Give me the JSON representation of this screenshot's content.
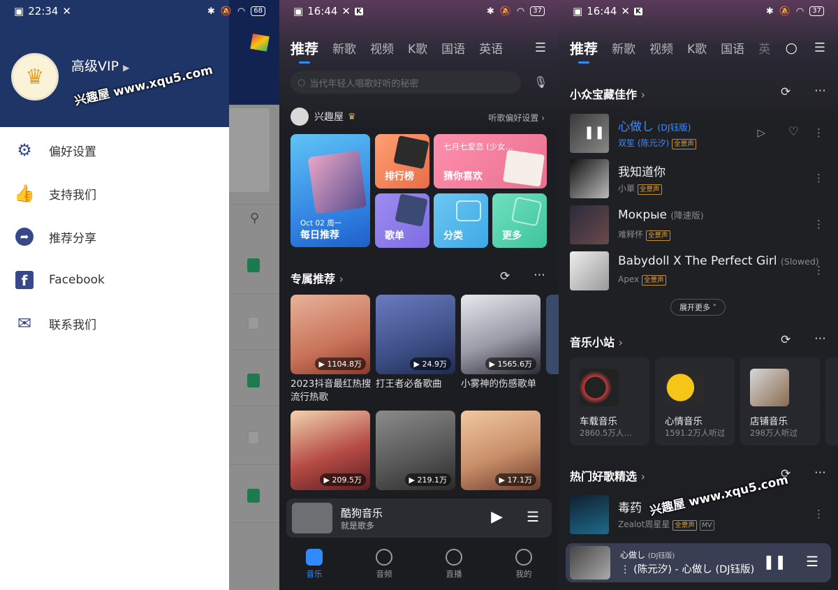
{
  "status_bar": [
    {
      "time": "22:34",
      "battery": "68"
    },
    {
      "time": "16:44",
      "battery": "37"
    },
    {
      "time": "16:44",
      "battery": "37"
    }
  ],
  "drawer": {
    "vip_label": "高级VIP",
    "watermark": "兴趣屋 www.xqu5.com",
    "menu": [
      {
        "label": "偏好设置",
        "icon": "gear-icon"
      },
      {
        "label": "支持我们",
        "icon": "thumbs-up-icon"
      },
      {
        "label": "推荐分享",
        "icon": "share-icon"
      },
      {
        "label": "Facebook",
        "icon": "facebook-icon"
      },
      {
        "label": "联系我们",
        "icon": "mail-icon"
      }
    ]
  },
  "music_home": {
    "tabs": [
      "推荐",
      "新歌",
      "视频",
      "K歌",
      "国语",
      "英语"
    ],
    "search_placeholder": "当代年轻人唱歌好听的秘密",
    "user_name": "兴趣屋",
    "pref_link": "听歌偏好设置 ›",
    "tiles": {
      "daily_date": "Oct 02 周一",
      "daily": "每日推荐",
      "rank": "排行榜",
      "guess": "猜你喜欢",
      "guess_sub": "七月七爱恋 (少女…",
      "songlist": "歌单",
      "category": "分类",
      "more": "更多"
    },
    "section_title": "专属推荐",
    "playlists": [
      {
        "count": "▶ 1104.8万",
        "title": "2023抖音最红热搜流行热歌",
        "color": "#c9735a"
      },
      {
        "count": "▶ 24.9万",
        "title": "打王者必备歌曲",
        "color": "#3d4f86"
      },
      {
        "count": "▶ 1565.6万",
        "title": "小雾神的伤感歌单",
        "color": "#9a9aa8"
      }
    ],
    "playlists2": [
      {
        "count": "▶ 209.5万",
        "color": "#b64b45"
      },
      {
        "count": "▶ 219.1万",
        "color": "#595959"
      },
      {
        "count": "▶ 17.1万",
        "color": "#c88e6a"
      }
    ],
    "mini_player": {
      "title": "酷狗音乐",
      "sub": "就是歌多"
    },
    "nav": [
      "音乐",
      "音频",
      "直播",
      "我的"
    ]
  },
  "music_feed": {
    "tabs": [
      "推荐",
      "新歌",
      "视频",
      "K歌",
      "国语",
      "英"
    ],
    "section1": "小众宝藏佳作",
    "songs": [
      {
        "title": "心做し",
        "sub": "(DJ钰版)",
        "artist": "双笙 (陈元汐)",
        "tag": "全景声"
      },
      {
        "title": "我知道你",
        "sub": "",
        "artist": "小單",
        "tag": "全景声"
      },
      {
        "title": "Мокрые",
        "sub": "(降速版)",
        "artist": "难释怀",
        "tag": "全景声"
      },
      {
        "title": "Babydoll X The Perfect Girl",
        "sub": "(Slowed)",
        "artist": "Apex",
        "tag": "全景声"
      }
    ],
    "expand_label": "展开更多 ˅",
    "section2": "音乐小站",
    "stations": [
      {
        "name": "车载音乐",
        "listeners": "2860.5万人…"
      },
      {
        "name": "心情音乐",
        "listeners": "1591.2万人听过"
      },
      {
        "name": "店铺音乐",
        "listeners": "298万人听过"
      }
    ],
    "section3": "热门好歌精选",
    "hot_song": {
      "title": "毒药",
      "artist": "Zealot周星星",
      "tag": "全景声",
      "mv": "MV"
    },
    "watermark": "兴趣屋 www.xqu5.com",
    "mini_player": {
      "title": "心做し",
      "title_sub": "(DJ钰版)",
      "line2": "(陈元汐) - 心做し (DJ钰版)"
    }
  }
}
